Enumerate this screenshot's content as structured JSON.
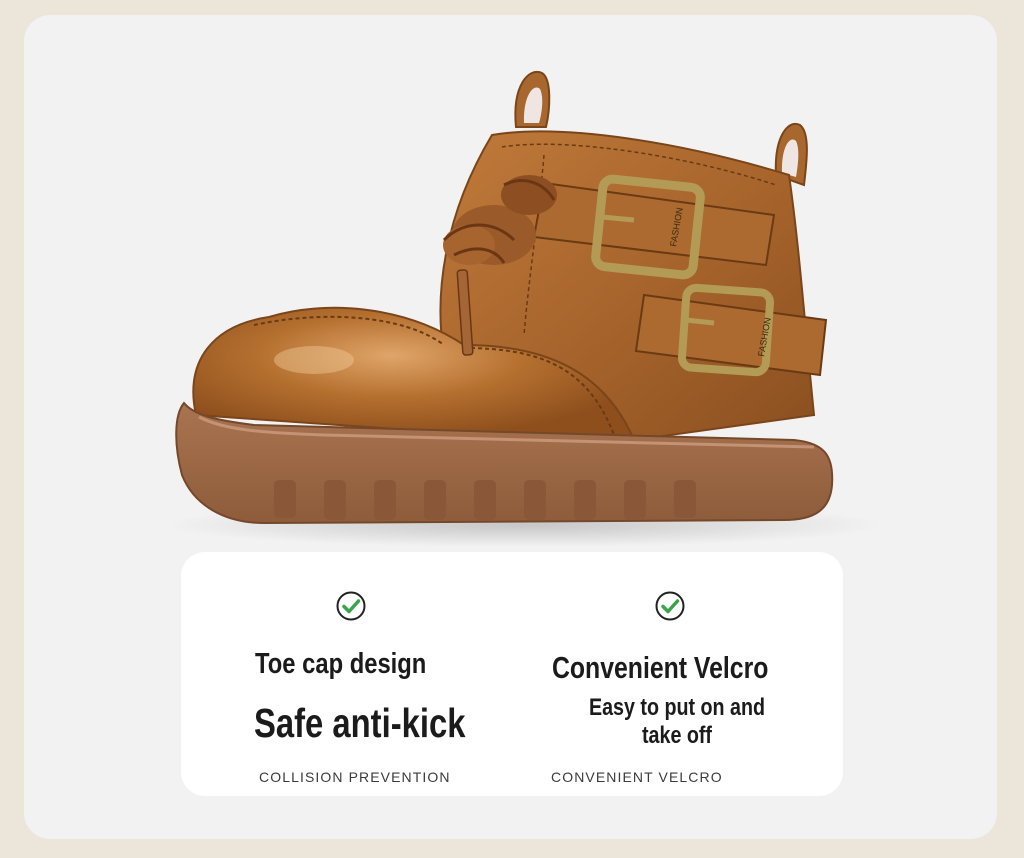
{
  "features": [
    {
      "check_icon": "green-checkmark-circle-icon",
      "heading": "Toe cap design",
      "headline": "Safe anti-kick",
      "caption": "COLLISION PREVENTION"
    },
    {
      "check_icon": "green-checkmark-circle-icon",
      "heading": "Convenient Velcro",
      "headline": "Easy to put on and take off",
      "caption": "CONVENIENT VELCRO"
    }
  ],
  "product": {
    "buckle_engraving": "FASHION"
  },
  "colors": {
    "background": "#ebe5da",
    "panel": "#f2f2f2",
    "leather": "#a8672e",
    "sole": "#9e6a44",
    "buckle": "#b39a55",
    "check": "#3aa44a"
  }
}
